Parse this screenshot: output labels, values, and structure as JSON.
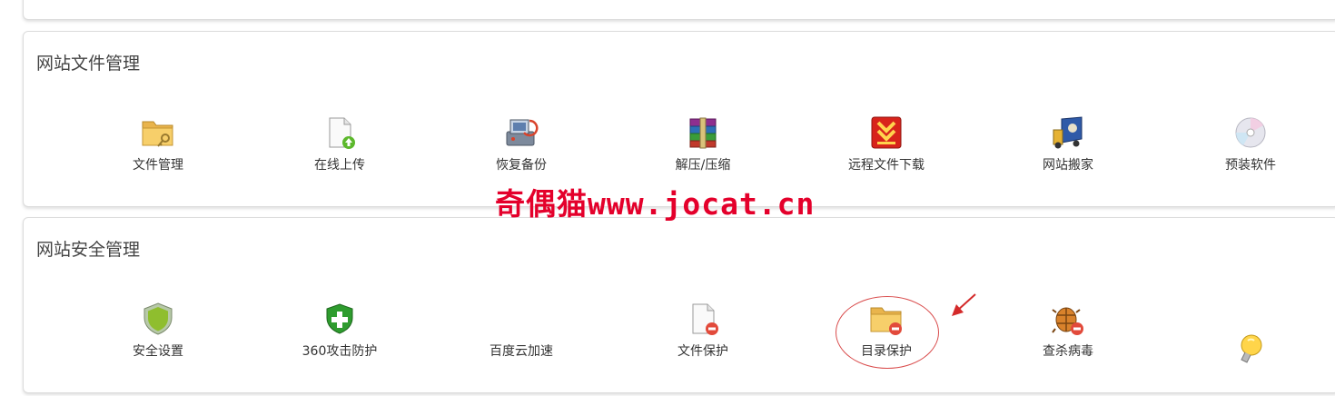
{
  "sections": [
    {
      "title": "网站文件管理",
      "items": [
        {
          "label": "文件管理",
          "icon": "folder-key-icon"
        },
        {
          "label": "在线上传",
          "icon": "file-upload-icon"
        },
        {
          "label": "恢复备份",
          "icon": "backup-restore-icon"
        },
        {
          "label": "解压/压缩",
          "icon": "archive-books-icon"
        },
        {
          "label": "远程文件下载",
          "icon": "remote-download-icon"
        },
        {
          "label": "网站搬家",
          "icon": "moving-truck-icon"
        },
        {
          "label": "预装软件",
          "icon": "cd-disc-icon"
        }
      ]
    },
    {
      "title": "网站安全管理",
      "items": [
        {
          "label": "安全设置",
          "icon": "shield-icon"
        },
        {
          "label": "360攻击防护",
          "icon": "shield-plus-icon"
        },
        {
          "label": "百度云加速",
          "icon": ""
        },
        {
          "label": "文件保护",
          "icon": "file-protect-icon"
        },
        {
          "label": "目录保护",
          "icon": "folder-protect-icon"
        },
        {
          "label": "查杀病毒",
          "icon": "bug-remove-icon"
        },
        {
          "label": "",
          "icon": "lightbulb-icon"
        }
      ]
    }
  ],
  "watermark": "奇偶猫www.jocat.cn",
  "annotation": {
    "highlight_color": "#d94b4b"
  }
}
